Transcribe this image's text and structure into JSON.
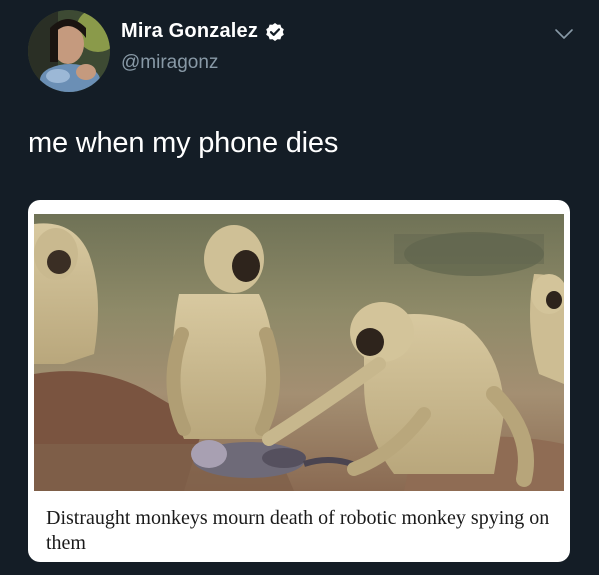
{
  "tweet": {
    "author_name": "Mira Gonzalez",
    "author_handle": "@miragonz",
    "verified": true,
    "text": "me when my phone dies"
  },
  "card": {
    "headline": "Distraught monkeys mourn death of robotic monkey spying on them"
  },
  "icons": {
    "verified": "verified-badge-icon",
    "menu": "chevron-down-icon"
  },
  "colors": {
    "background": "#141d26",
    "name": "#ffffff",
    "handle": "#8899a6",
    "card_bg": "#ffffff"
  }
}
